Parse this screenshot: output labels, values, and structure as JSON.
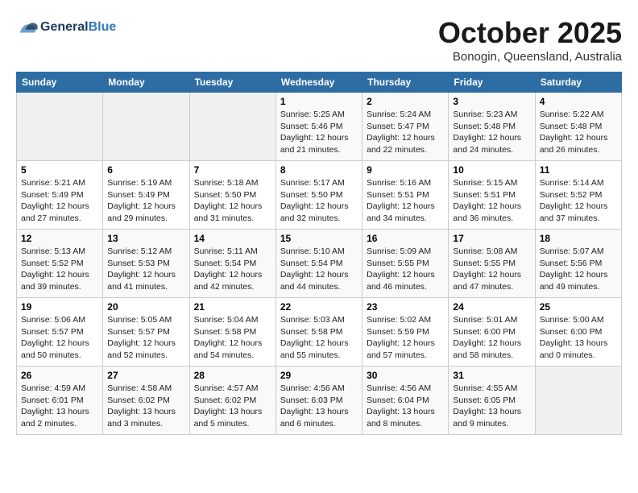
{
  "header": {
    "logo_line1": "General",
    "logo_line2": "Blue",
    "month": "October 2025",
    "location": "Bonogin, Queensland, Australia"
  },
  "days_of_week": [
    "Sunday",
    "Monday",
    "Tuesday",
    "Wednesday",
    "Thursday",
    "Friday",
    "Saturday"
  ],
  "weeks": [
    [
      {
        "day": "",
        "info": ""
      },
      {
        "day": "",
        "info": ""
      },
      {
        "day": "",
        "info": ""
      },
      {
        "day": "1",
        "info": "Sunrise: 5:25 AM\nSunset: 5:46 PM\nDaylight: 12 hours\nand 21 minutes."
      },
      {
        "day": "2",
        "info": "Sunrise: 5:24 AM\nSunset: 5:47 PM\nDaylight: 12 hours\nand 22 minutes."
      },
      {
        "day": "3",
        "info": "Sunrise: 5:23 AM\nSunset: 5:48 PM\nDaylight: 12 hours\nand 24 minutes."
      },
      {
        "day": "4",
        "info": "Sunrise: 5:22 AM\nSunset: 5:48 PM\nDaylight: 12 hours\nand 26 minutes."
      }
    ],
    [
      {
        "day": "5",
        "info": "Sunrise: 5:21 AM\nSunset: 5:49 PM\nDaylight: 12 hours\nand 27 minutes."
      },
      {
        "day": "6",
        "info": "Sunrise: 5:19 AM\nSunset: 5:49 PM\nDaylight: 12 hours\nand 29 minutes."
      },
      {
        "day": "7",
        "info": "Sunrise: 5:18 AM\nSunset: 5:50 PM\nDaylight: 12 hours\nand 31 minutes."
      },
      {
        "day": "8",
        "info": "Sunrise: 5:17 AM\nSunset: 5:50 PM\nDaylight: 12 hours\nand 32 minutes."
      },
      {
        "day": "9",
        "info": "Sunrise: 5:16 AM\nSunset: 5:51 PM\nDaylight: 12 hours\nand 34 minutes."
      },
      {
        "day": "10",
        "info": "Sunrise: 5:15 AM\nSunset: 5:51 PM\nDaylight: 12 hours\nand 36 minutes."
      },
      {
        "day": "11",
        "info": "Sunrise: 5:14 AM\nSunset: 5:52 PM\nDaylight: 12 hours\nand 37 minutes."
      }
    ],
    [
      {
        "day": "12",
        "info": "Sunrise: 5:13 AM\nSunset: 5:52 PM\nDaylight: 12 hours\nand 39 minutes."
      },
      {
        "day": "13",
        "info": "Sunrise: 5:12 AM\nSunset: 5:53 PM\nDaylight: 12 hours\nand 41 minutes."
      },
      {
        "day": "14",
        "info": "Sunrise: 5:11 AM\nSunset: 5:54 PM\nDaylight: 12 hours\nand 42 minutes."
      },
      {
        "day": "15",
        "info": "Sunrise: 5:10 AM\nSunset: 5:54 PM\nDaylight: 12 hours\nand 44 minutes."
      },
      {
        "day": "16",
        "info": "Sunrise: 5:09 AM\nSunset: 5:55 PM\nDaylight: 12 hours\nand 46 minutes."
      },
      {
        "day": "17",
        "info": "Sunrise: 5:08 AM\nSunset: 5:55 PM\nDaylight: 12 hours\nand 47 minutes."
      },
      {
        "day": "18",
        "info": "Sunrise: 5:07 AM\nSunset: 5:56 PM\nDaylight: 12 hours\nand 49 minutes."
      }
    ],
    [
      {
        "day": "19",
        "info": "Sunrise: 5:06 AM\nSunset: 5:57 PM\nDaylight: 12 hours\nand 50 minutes."
      },
      {
        "day": "20",
        "info": "Sunrise: 5:05 AM\nSunset: 5:57 PM\nDaylight: 12 hours\nand 52 minutes."
      },
      {
        "day": "21",
        "info": "Sunrise: 5:04 AM\nSunset: 5:58 PM\nDaylight: 12 hours\nand 54 minutes."
      },
      {
        "day": "22",
        "info": "Sunrise: 5:03 AM\nSunset: 5:58 PM\nDaylight: 12 hours\nand 55 minutes."
      },
      {
        "day": "23",
        "info": "Sunrise: 5:02 AM\nSunset: 5:59 PM\nDaylight: 12 hours\nand 57 minutes."
      },
      {
        "day": "24",
        "info": "Sunrise: 5:01 AM\nSunset: 6:00 PM\nDaylight: 12 hours\nand 58 minutes."
      },
      {
        "day": "25",
        "info": "Sunrise: 5:00 AM\nSunset: 6:00 PM\nDaylight: 13 hours\nand 0 minutes."
      }
    ],
    [
      {
        "day": "26",
        "info": "Sunrise: 4:59 AM\nSunset: 6:01 PM\nDaylight: 13 hours\nand 2 minutes."
      },
      {
        "day": "27",
        "info": "Sunrise: 4:58 AM\nSunset: 6:02 PM\nDaylight: 13 hours\nand 3 minutes."
      },
      {
        "day": "28",
        "info": "Sunrise: 4:57 AM\nSunset: 6:02 PM\nDaylight: 13 hours\nand 5 minutes."
      },
      {
        "day": "29",
        "info": "Sunrise: 4:56 AM\nSunset: 6:03 PM\nDaylight: 13 hours\nand 6 minutes."
      },
      {
        "day": "30",
        "info": "Sunrise: 4:56 AM\nSunset: 6:04 PM\nDaylight: 13 hours\nand 8 minutes."
      },
      {
        "day": "31",
        "info": "Sunrise: 4:55 AM\nSunset: 6:05 PM\nDaylight: 13 hours\nand 9 minutes."
      },
      {
        "day": "",
        "info": ""
      }
    ]
  ]
}
